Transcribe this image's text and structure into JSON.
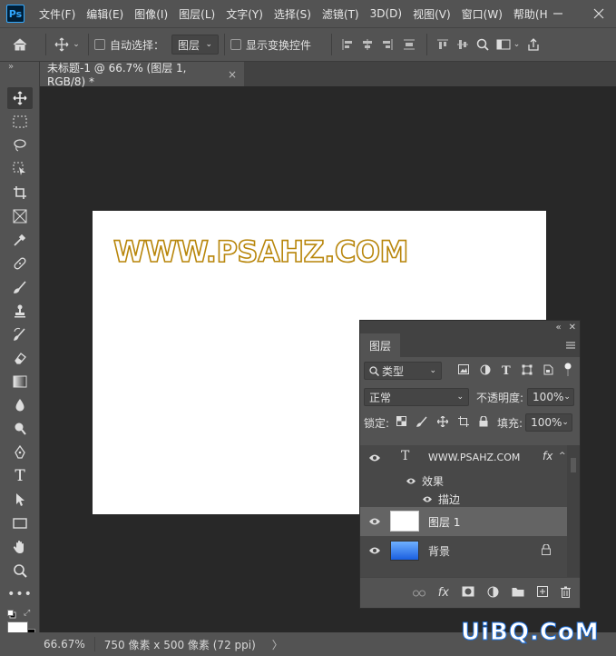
{
  "menu": [
    "文件(F)",
    "编辑(E)",
    "图像(I)",
    "图层(L)",
    "文字(Y)",
    "选择(S)",
    "滤镜(T)",
    "3D(D)",
    "视图(V)",
    "窗口(W)",
    "帮助(H"
  ],
  "app_logo": "Ps",
  "options": {
    "auto_select_label": "自动选择：",
    "auto_select_target": "图层",
    "show_transform_label": "显示变换控件"
  },
  "document_tab": {
    "title": "未标题-1 @ 66.7% (图层 1, RGB/8) *",
    "close": "×"
  },
  "canvas": {
    "text": "WWW.PSAHZ.COM",
    "stroke_color": "#b8860b"
  },
  "status": {
    "zoom": "66.67%",
    "doc_info": "750 像素 x 500 像素 (72 ppi)",
    "arrow": "〉"
  },
  "layers_panel": {
    "tab_label": "图层",
    "filter_type": "类型",
    "blend_mode": "正常",
    "opacity_label": "不透明度:",
    "opacity_value": "100%",
    "lock_label": "锁定:",
    "fill_label": "填充:",
    "fill_value": "100%",
    "layers": [
      {
        "name": "WWW.PSAHZ.COM",
        "kind": "text",
        "fx": "fx"
      },
      {
        "name": "效果",
        "kind": "effects"
      },
      {
        "name": "描边",
        "kind": "effect"
      },
      {
        "name": "图层 1",
        "kind": "pixel",
        "selected": true
      },
      {
        "name": "背景",
        "kind": "background",
        "locked": true
      }
    ]
  },
  "watermark": "UiBQ.CoM",
  "colors": {
    "fg": "#ffffff",
    "bg": "#000000",
    "accent": "#31a8ff"
  }
}
